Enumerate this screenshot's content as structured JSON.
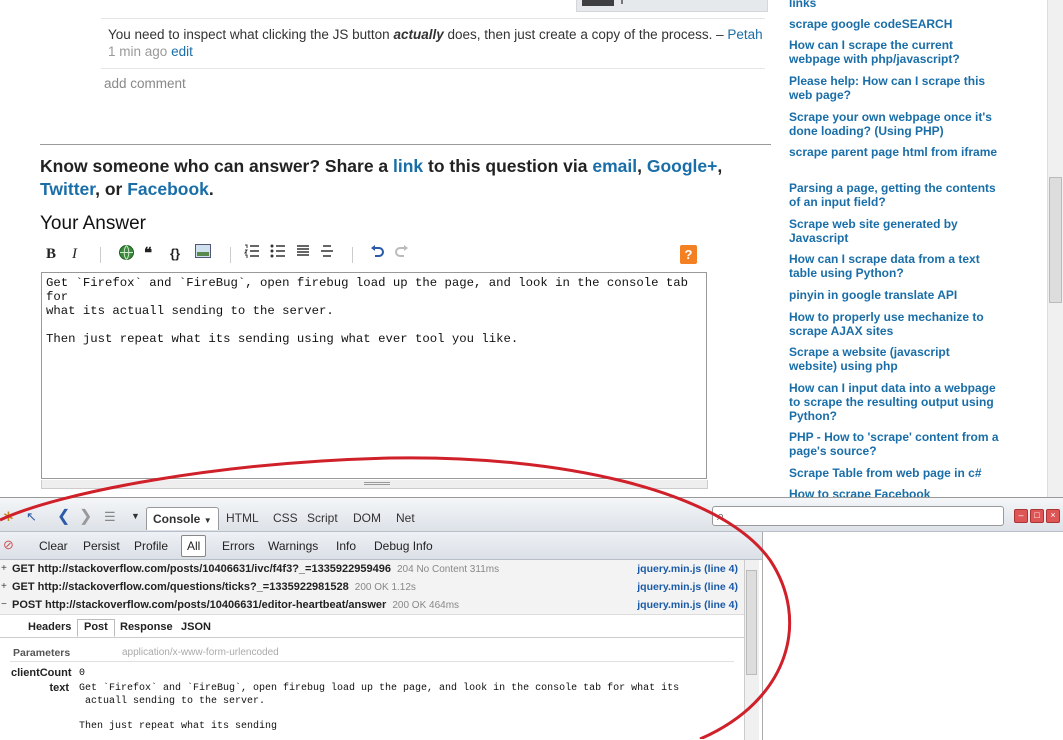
{
  "comment": {
    "text_before": "You need to inspect what clicking the JS button ",
    "emphasis": "actually",
    "text_after": " does, then just create a copy of the process. – ",
    "author": "Petah",
    "time": "1 min ago",
    "edit": "edit"
  },
  "add_comment": "add comment",
  "share": {
    "prefix": "Know someone who can answer? Share a ",
    "link": "link",
    "mid": " to this question via ",
    "email": "email",
    "google": "Google+",
    "twitter": "Twitter",
    "or": ", or ",
    "facebook": "Facebook",
    "comma": ", ",
    "end": "."
  },
  "your_answer": "Your Answer",
  "editor_toolbar": {
    "bold": "B",
    "italic": "I",
    "quote": "❝",
    "code": "{}",
    "help": "?"
  },
  "editor_text": "Get `Firefox` and `FireBug`, open firebug load up the page, and look in the console tab for\nwhat its actuall sending to the server.\n\nThen just repeat what its sending using what ever tool you like.",
  "related": [
    "links",
    "scrape google codeSEARCH",
    "How can I scrape the current webpage with php/javascript?",
    "Please help: How can I scrape this web page?",
    "Scrape your own webpage once it's done loading? (Using PHP)",
    "scrape parent page html from iframe",
    "Parsing a page, getting the contents of an input field?",
    "Scrape web site generated by Javascript",
    "How can I scrape data from a text table using Python?",
    "pinyin in google translate API",
    "How to properly use mechanize to scrape AJAX sites",
    "Scrape a website (javascript website) using php",
    "How can I input data into a webpage to scrape the resulting output using Python?",
    "PHP - How to 'scrape' content from a page's source?",
    "Scrape Table from web page in c#",
    "How to scrape Facebook"
  ],
  "firebug": {
    "tabs": [
      "Console",
      "HTML",
      "CSS",
      "Script",
      "DOM",
      "Net"
    ],
    "console_buttons": [
      "Clear",
      "Persist",
      "Profile",
      "All",
      "Errors",
      "Warnings",
      "Info",
      "Debug Info"
    ],
    "requests": [
      {
        "toggle": "+",
        "method": "GET http://stackoverflow.com/posts/10406631/ivc/f4f3?_=1335922959496",
        "status": "204 No Content 311ms",
        "source": "jquery.min.js (line 4)"
      },
      {
        "toggle": "+",
        "method": "GET http://stackoverflow.com/questions/ticks?_=1335922981528",
        "status": "200 OK 1.12s",
        "source": "jquery.min.js (line 4)"
      },
      {
        "toggle": "−",
        "method": "POST http://stackoverflow.com/posts/10406631/editor-heartbeat/answer",
        "status": "200 OK 464ms",
        "source": "jquery.min.js (line 4)"
      }
    ],
    "response_tabs": [
      "Headers",
      "Post",
      "Response",
      "JSON"
    ],
    "params_header": "Parameters",
    "content_type": "application/x-www-form-urlencoded",
    "params": [
      {
        "key": "clientCount",
        "value": "0"
      },
      {
        "key": "text",
        "value": "Get `Firefox` and `FireBug`, open firebug load up the page, and look in the console tab for what its\n actuall sending to the server.\n\nThen just repeat what its sending"
      }
    ]
  },
  "colors": {
    "link": "#1a6ea8",
    "annotation": "#d0202a",
    "help": "#f48024"
  }
}
